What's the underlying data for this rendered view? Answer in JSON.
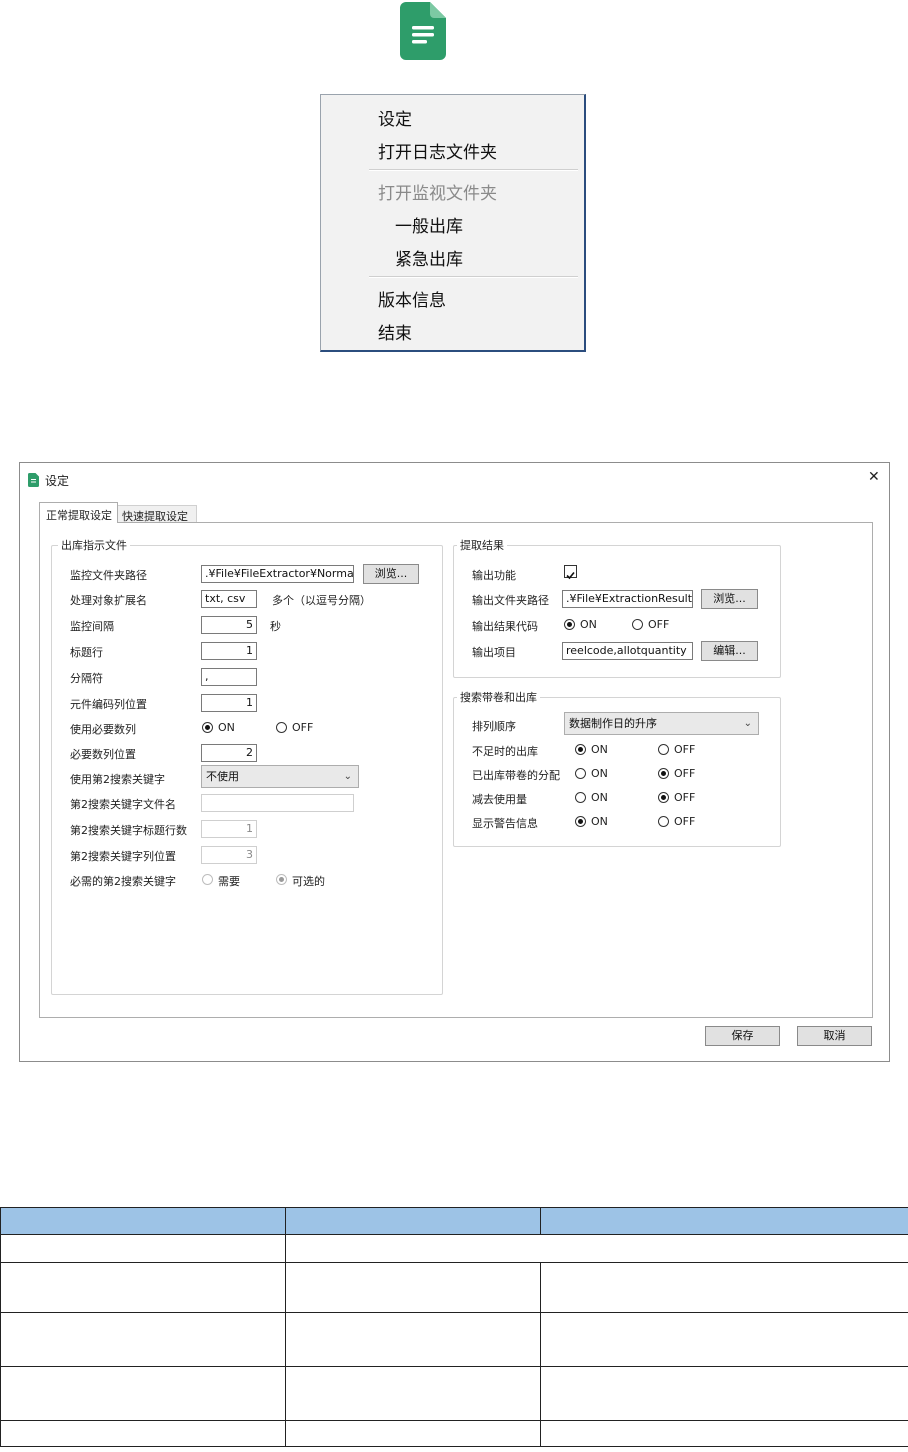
{
  "colors": {
    "accent": "#2e9d6a",
    "table_header": "#9dc3e6",
    "menu_border": "#2b4d7e"
  },
  "app_icon": {
    "name": "document-icon",
    "color": "#2e9d6a"
  },
  "context_menu": {
    "items": [
      {
        "label": "设定",
        "enabled": true
      },
      {
        "label": "打开日志文件夹",
        "enabled": true
      },
      {
        "label": "打开监视文件夹",
        "enabled": false
      },
      {
        "label": "一般出库",
        "enabled": true
      },
      {
        "label": "紧急出库",
        "enabled": true
      },
      {
        "label": "版本信息",
        "enabled": true
      },
      {
        "label": "结束",
        "enabled": true
      }
    ]
  },
  "dialog": {
    "title": "设定",
    "close": "✕",
    "tabs": [
      "正常提取设定",
      "快速提取设定"
    ],
    "left_group": {
      "title": "出库指示文件",
      "monitor_folder_label": "监控文件夹路径",
      "monitor_folder_value": ".¥File¥FileExtractor¥Normal",
      "browse_label": "浏览...",
      "ext_label": "处理对象扩展名",
      "ext_value": "txt, csv",
      "ext_note": "多个（以逗号分隔）",
      "interval_label": "监控间隔",
      "interval_value": "5",
      "interval_unit": "秒",
      "title_row_label": "标题行",
      "title_row_value": "1",
      "separator_label": "分隔符",
      "separator_value": ",",
      "part_col_label": "元件编码列位置",
      "part_col_value": "1",
      "use_qty_label": "使用必要数列",
      "on": "ON",
      "off": "OFF",
      "qty_col_label": "必要数列位置",
      "qty_col_value": "2",
      "use_key2_label": "使用第2搜索关键字",
      "use_key2_value": "不使用",
      "key2_file_label": "第2搜索关键字文件名",
      "key2_file_value": "",
      "key2_title_label": "第2搜索关键字标题行数",
      "key2_title_value": "1",
      "key2_col_label": "第2搜索关键字列位置",
      "key2_col_value": "3",
      "key2_required_label": "必需的第2搜索关键字",
      "required_opt": "需要",
      "optional_opt": "可选的"
    },
    "result_group": {
      "title": "提取结果",
      "output_label": "输出功能",
      "output_checked": true,
      "folder_label": "输出文件夹路径",
      "folder_value": ".¥File¥ExtractionResult",
      "browse_label": "浏览...",
      "code_label": "输出结果代码",
      "items_label": "输出项目",
      "items_value": "reelcode,allotquantity",
      "edit_label": "编辑..."
    },
    "search_group": {
      "title": "搜索带卷和出库",
      "sort_label": "排列顺序",
      "sort_value": "数据制作日的升序",
      "shortage_label": "不足时的出库",
      "allocated_label": "已出库带卷的分配",
      "subtract_label": "减去使用量",
      "warning_label": "显示警告信息"
    },
    "save_label": "保存",
    "cancel_label": "取消"
  }
}
